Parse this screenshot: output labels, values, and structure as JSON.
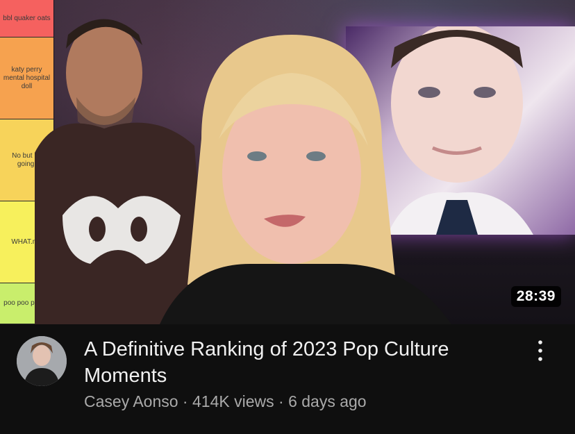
{
  "tier_list": {
    "rows": [
      {
        "label": "bbl quaker oats",
        "color": "#f5615f"
      },
      {
        "label": "katy perry mental hospital doll",
        "color": "#f6a24f"
      },
      {
        "label": "No but ke going!",
        "color": "#f7d35a"
      },
      {
        "label": "WHAT.mp",
        "color": "#f7f05c"
      },
      {
        "label": "poo poo platter",
        "color": "#c9ee6c"
      }
    ]
  },
  "video": {
    "duration": "28:39",
    "title": "A Definitive Ranking of 2023 Pop Culture Moments",
    "channel": "Casey Aonso",
    "views": "414K views",
    "age": "6 days ago",
    "separator": "·"
  },
  "icons": {
    "menu": "more-vert-icon"
  },
  "colors": {
    "background": "#0f0f0f",
    "title_text": "#f1f1f1",
    "meta_text": "#aaaaaa"
  }
}
